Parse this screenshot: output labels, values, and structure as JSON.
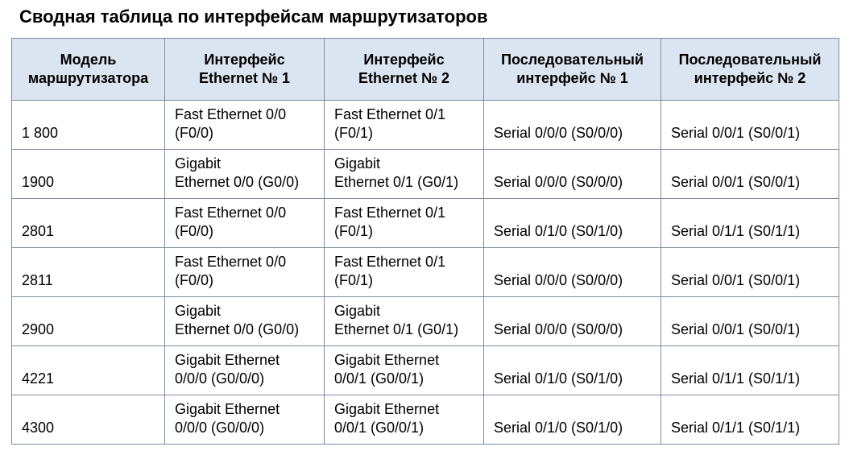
{
  "title": "Сводная таблица по интерфейсам маршрутизаторов",
  "table": {
    "headers": [
      [
        "Модель",
        "маршрутизатора"
      ],
      [
        "Интерфейс",
        "Ethernet № 1"
      ],
      [
        "Интерфейс",
        "Ethernet № 2"
      ],
      [
        "Последовательный",
        "интерфейс № 1"
      ],
      [
        "Последовательный",
        "интерфейс № 2"
      ]
    ],
    "rows": [
      {
        "model": "1 800",
        "eth1": [
          "Fast Ethernet 0/0",
          "(F0/0)"
        ],
        "eth2": [
          "Fast Ethernet 0/1",
          "(F0/1)"
        ],
        "ser1": "Serial 0/0/0 (S0/0/0)",
        "ser2": "Serial 0/0/1 (S0/0/1)"
      },
      {
        "model": "1900",
        "eth1": [
          "Gigabit",
          "Ethernet 0/0 (G0/0)"
        ],
        "eth2": [
          "Gigabit",
          "Ethernet 0/1 (G0/1)"
        ],
        "ser1": "Serial 0/0/0 (S0/0/0)",
        "ser2": "Serial 0/0/1 (S0/0/1)"
      },
      {
        "model": "2801",
        "eth1": [
          "Fast Ethernet 0/0",
          "(F0/0)"
        ],
        "eth2": [
          "Fast Ethernet 0/1",
          "(F0/1)"
        ],
        "ser1": "Serial 0/1/0 (S0/1/0)",
        "ser2": "Serial 0/1/1 (S0/1/1)"
      },
      {
        "model": "2811",
        "eth1": [
          "Fast Ethernet 0/0",
          "(F0/0)"
        ],
        "eth2": [
          "Fast Ethernet 0/1",
          "(F0/1)"
        ],
        "ser1": "Serial 0/0/0 (S0/0/0)",
        "ser2": "Serial 0/0/1 (S0/0/1)"
      },
      {
        "model": "2900",
        "eth1": [
          "Gigabit",
          "Ethernet 0/0 (G0/0)"
        ],
        "eth2": [
          "Gigabit",
          "Ethernet 0/1 (G0/1)"
        ],
        "ser1": "Serial 0/0/0 (S0/0/0)",
        "ser2": "Serial 0/0/1 (S0/0/1)"
      },
      {
        "model": "4221",
        "eth1": [
          "Gigabit Ethernet",
          "0/0/0 (G0/0/0)"
        ],
        "eth2": [
          "Gigabit Ethernet",
          "0/0/1 (G0/0/1)"
        ],
        "ser1": "Serial 0/1/0 (S0/1/0)",
        "ser2": "Serial 0/1/1 (S0/1/1)"
      },
      {
        "model": "4300",
        "eth1": [
          "Gigabit Ethernet",
          "0/0/0 (G0/0/0)"
        ],
        "eth2": [
          "Gigabit Ethernet",
          "0/0/1 (G0/0/1)"
        ],
        "ser1": "Serial 0/1/0 (S0/1/0)",
        "ser2": "Serial 0/1/1 (S0/1/1)"
      }
    ]
  }
}
